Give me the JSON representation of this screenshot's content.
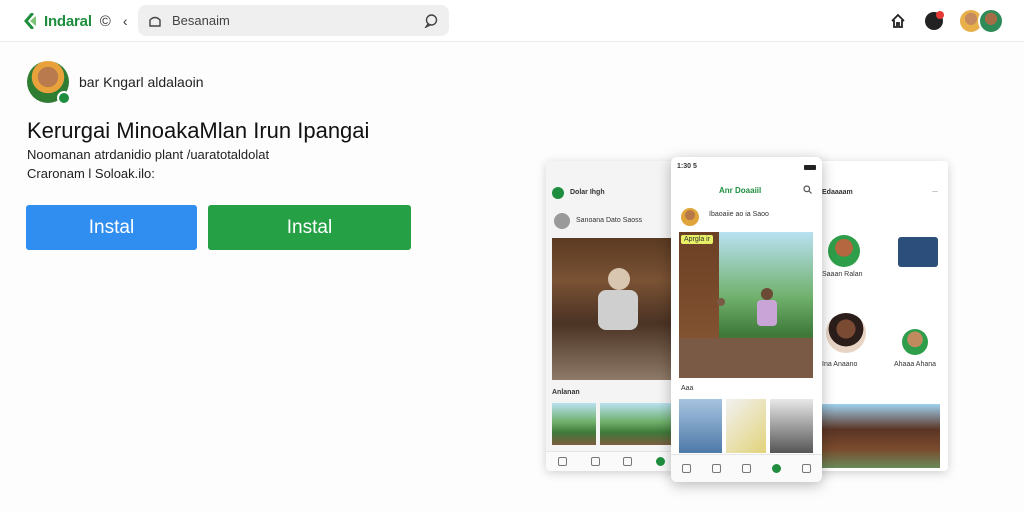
{
  "header": {
    "brand_name": "Indaral",
    "brand_extra": "©",
    "search_text": "Besanaim",
    "icons": [
      "leaf-logo-icon",
      "chevron-left-icon",
      "search-icon",
      "chat-bubble-icon",
      "home-icon",
      "notification-icon"
    ]
  },
  "hero": {
    "profile_name": "bar Kngarl aldalaoin",
    "headline": "Kerurgai MinoakaMlan Irun Ipangai",
    "description_line1": "Noomanan atrdanidio plant /uaratotaldolat",
    "description_line2": "Craronam l Soloak.ilo:",
    "install_blue_label": "Instal",
    "install_green_label": "Instal",
    "colors": {
      "blue": "#2f8ef0",
      "green": "#25a045",
      "brand": "#1e8e3e"
    }
  },
  "mockup": {
    "left_phone": {
      "title": "Dolar Ihgh",
      "post_title": "Sanoana Dato Saoss",
      "section_label": "Anlanan"
    },
    "center_phone": {
      "status_time": "1:30 5",
      "app_title": "Anr Doaaiil",
      "post_title": "Ibaoaiie ao ia Saoo",
      "tag_label": "Aprgla ir",
      "row_label": "Aaa"
    },
    "right_phone": {
      "title": "Edaaaam",
      "more": "...",
      "row_label_1": "Saaan Ralan",
      "row_label_2": "Ina Anaano",
      "row_label_3": "Ahaaa Ahana"
    }
  }
}
